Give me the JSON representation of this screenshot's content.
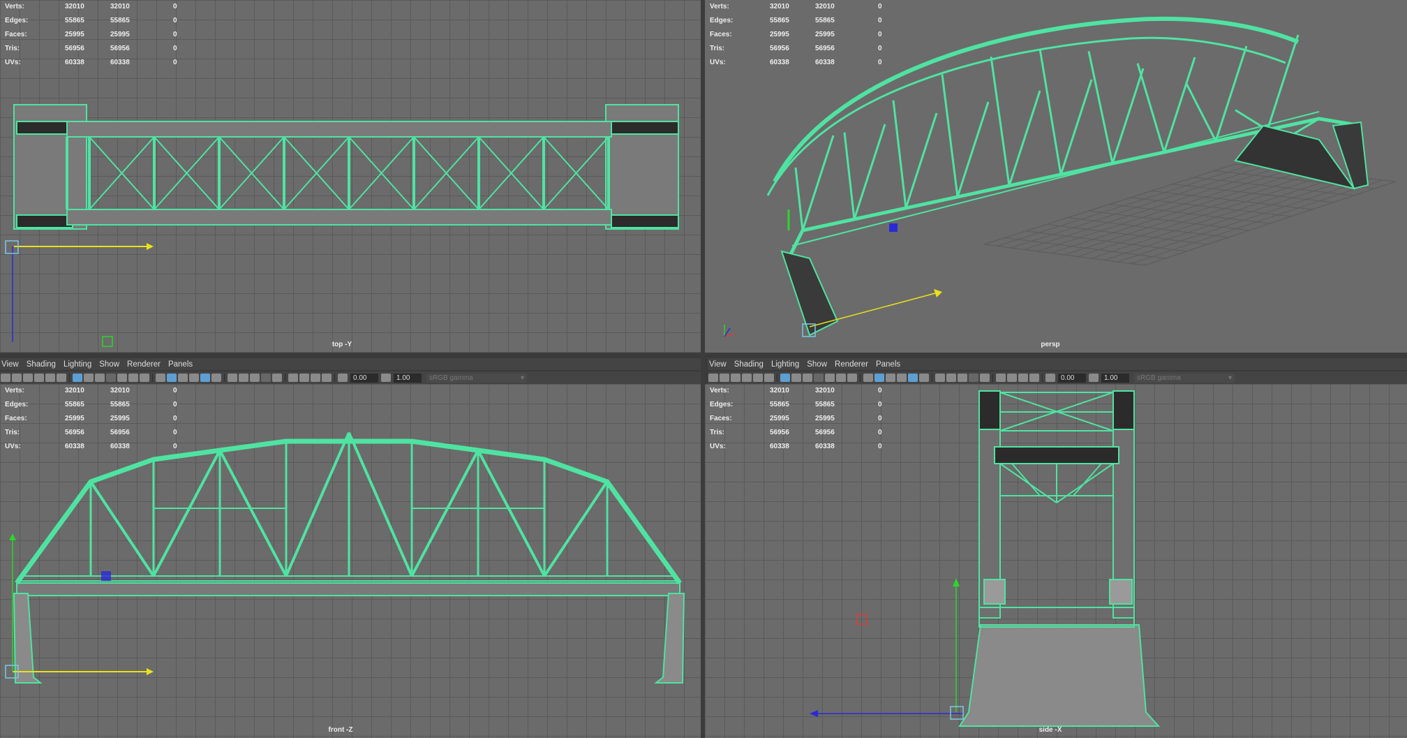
{
  "stats": {
    "rows": [
      {
        "label": "Verts:",
        "v1": "32010",
        "v2": "32010",
        "v3": "0"
      },
      {
        "label": "Edges:",
        "v1": "55865",
        "v2": "55865",
        "v3": "0"
      },
      {
        "label": "Faces:",
        "v1": "25995",
        "v2": "25995",
        "v3": "0"
      },
      {
        "label": "Tris:",
        "v1": "56956",
        "v2": "56956",
        "v3": "0"
      },
      {
        "label": "UVs:",
        "v1": "60338",
        "v2": "60338",
        "v3": "0"
      }
    ]
  },
  "viewports": {
    "top": {
      "camera": "top -Y"
    },
    "persp": {
      "camera": "persp"
    },
    "front": {
      "camera": "front -Z"
    },
    "side": {
      "camera": "side -X"
    }
  },
  "menu": {
    "view": "View",
    "shading": "Shading",
    "lighting": "Lighting",
    "show": "Show",
    "renderer": "Renderer",
    "panels": "Panels"
  },
  "toolbar": {
    "exposure": "0.00",
    "gamma_value": "1.00",
    "color_space": "sRGB gamma"
  },
  "colors": {
    "wireframe": "#4fe3a2",
    "grid": "#5a5a5a",
    "background": "#6b6b6b",
    "x_axis": "#e8e21a",
    "z_axis": "#2a2ad6",
    "y_axis": "#2bd62b"
  }
}
